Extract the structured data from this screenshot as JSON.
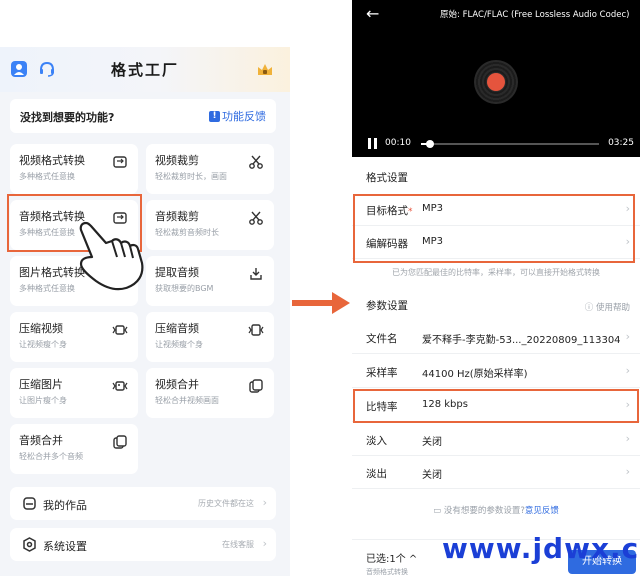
{
  "left": {
    "header": {
      "title": "格式工厂"
    },
    "banner": {
      "question": "没找到想要的功能?",
      "feedback": "功能反馈"
    },
    "cards": [
      {
        "title": "视频格式转换",
        "sub": "多种格式任意换",
        "icon": "convert-icon"
      },
      {
        "title": "视频裁剪",
        "sub": "轻松裁剪时长，画面",
        "icon": "scissors-icon"
      },
      {
        "title": "音频格式转换",
        "sub": "多种格式任意换",
        "icon": "convert-icon"
      },
      {
        "title": "音频裁剪",
        "sub": "轻松裁剪音频时长",
        "icon": "scissors-icon"
      },
      {
        "title": "图片格式转换",
        "sub": "多种格式任意换",
        "icon": "convert-icon"
      },
      {
        "title": "提取音频",
        "sub": "获取想要的BGM",
        "icon": "extract-icon"
      },
      {
        "title": "压缩视频",
        "sub": "让视频瘦个身",
        "icon": "compress-video-icon"
      },
      {
        "title": "压缩音频",
        "sub": "让视频瘦个身",
        "icon": "compress-audio-icon"
      },
      {
        "title": "压缩图片",
        "sub": "让图片瘦个身",
        "icon": "compress-image-icon"
      },
      {
        "title": "视频合并",
        "sub": "轻松合并视频画面",
        "icon": "merge-icon"
      },
      {
        "title": "音频合并",
        "sub": "轻松合并多个音频",
        "icon": "merge-icon"
      }
    ],
    "works": {
      "label": "我的作品",
      "hint": "历史文件都在这"
    },
    "settings": {
      "label": "系统设置",
      "hint": "在线客服"
    }
  },
  "right": {
    "player": {
      "original": "原始: FLAC/FLAC (Free Lossless Audio Codec)",
      "current": "00:10",
      "duration": "03:25",
      "progress": 0.05
    },
    "format_section": "格式设置",
    "target_format": {
      "label": "目标格式",
      "star": "*",
      "value": "MP3"
    },
    "codec": {
      "label": "编解码器",
      "value": "MP3"
    },
    "hint": "已为您匹配最佳的比特率，采样率，可以直接开始格式转换",
    "param_section": "参数设置",
    "help": "使用帮助",
    "params": [
      {
        "label": "文件名",
        "value": "爱不释手-李克勤-53..._20220809_113304"
      },
      {
        "label": "采样率",
        "value": "44100 Hz(原始采样率)"
      },
      {
        "label": "比特率",
        "value": "128 kbps"
      },
      {
        "label": "淡入",
        "value": "关闭"
      },
      {
        "label": "淡出",
        "value": "关闭"
      }
    ],
    "missing": {
      "text": "没有想要的参数设置?",
      "link": "意见反馈"
    },
    "bottom": {
      "selected": "已选:1个",
      "sub": "音频格式转换",
      "start": "开始转换"
    }
  },
  "watermark": "www.jdwx.cn",
  "colors": {
    "accent": "#2f6be0",
    "highlight": "#e8663b"
  }
}
